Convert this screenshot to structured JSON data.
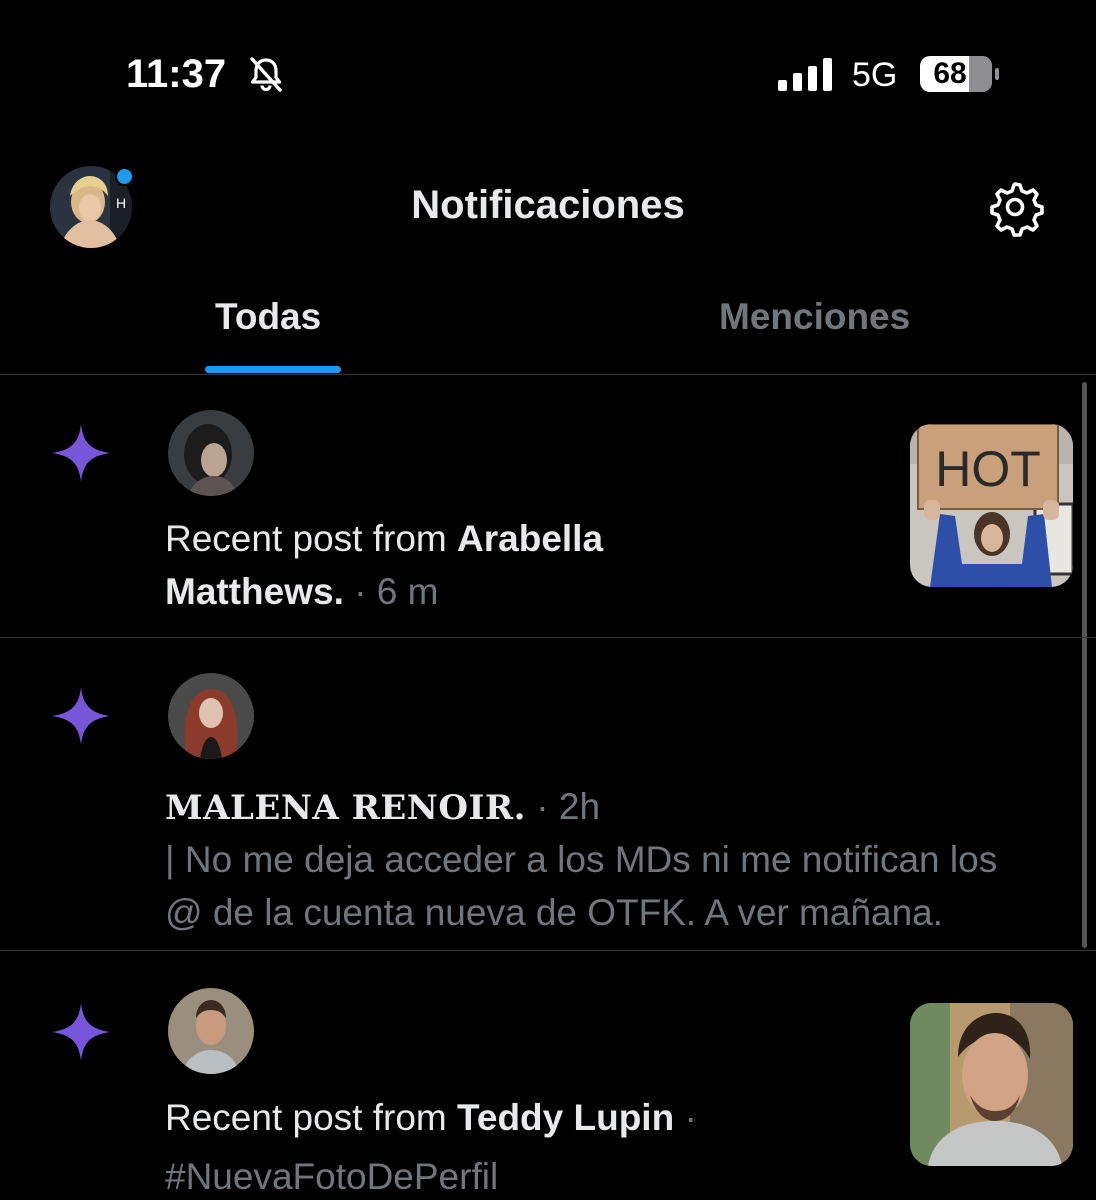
{
  "status_bar": {
    "time": "11:37",
    "network": "5G",
    "battery": "68",
    "battery_level": 0.68
  },
  "header": {
    "title": "Notificaciones"
  },
  "tabs": [
    {
      "label": "Todas"
    },
    {
      "label": "Menciones"
    }
  ],
  "notifications": [
    {
      "prefix": "Recent post from ",
      "name_part1": "Arabella",
      "name_part2": "Matthews.",
      "time": " · 6 m",
      "thumb_text": "HOT"
    },
    {
      "name": "MALENA RENOIR.",
      "time": " · 2h",
      "body_line1": "| No me deja acceder a los MDs ni me notifican los",
      "body_line2": "@ de la cuenta nueva de OTFK. A ver mañana."
    },
    {
      "prefix": "Recent post from ",
      "name": "Teddy Lupin",
      "separator": " ·",
      "hashtag": "#NuevaFotoDePerfil"
    }
  ],
  "colors": {
    "accent": "#1d9bf0",
    "spark": "#7856d9",
    "muted": "#71767b",
    "background": "#000000"
  }
}
